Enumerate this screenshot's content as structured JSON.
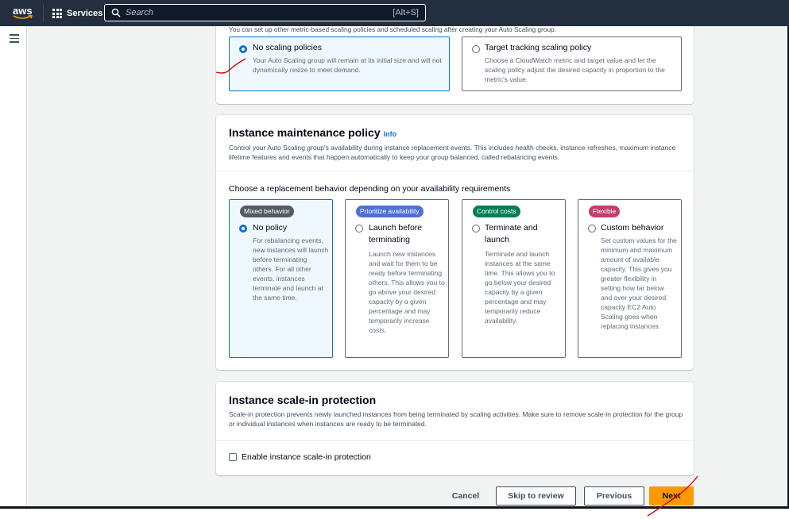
{
  "topbar": {
    "logo": "aws",
    "services_label": "Services",
    "search_placeholder": "Search",
    "search_shortcut": "[Alt+S]"
  },
  "scaling_policies": {
    "intro": "You can set up other metric-based scaling policies and scheduled scaling after creating your Auto Scaling group.",
    "options": [
      {
        "label": "No scaling policies",
        "description": "Your Auto Scaling group will remain at its initial size and will not dynamically resize to meet demand.",
        "selected": true
      },
      {
        "label": "Target tracking scaling policy",
        "description": "Choose a CloudWatch metric and target value and let the scaling policy adjust the desired capacity in proportion to the metric's value.",
        "selected": false
      }
    ]
  },
  "maintenance": {
    "title": "Instance maintenance policy",
    "info": "Info",
    "description": "Control your Auto Scaling group's availability during instance replacement events. This includes health checks, instance refreshes, maximum instance lifetime features and events that happen automatically to keep your group balanced, called rebalancing events.",
    "choose_label": "Choose a replacement behavior depending on your availability requirements",
    "options": [
      {
        "badge": "Mixed behavior",
        "badge_color": "#545b64",
        "label": "No policy",
        "description": "For rebalancing events, new instances will launch before terminating others. For all other events, instances terminate and launch at the same time.",
        "selected": true
      },
      {
        "badge": "Prioritize availability",
        "badge_color": "#4e6fd6",
        "label": "Launch before terminating",
        "description": "Launch new instances and wait for them to be ready before terminating others. This allows you to go above your desired capacity by a given percentage and may temporarily increase costs.",
        "selected": false
      },
      {
        "badge": "Control costs",
        "badge_color": "#037f51",
        "label": "Terminate and launch",
        "description": "Terminate and launch instances at the same time. This allows you to go below your desired capacity by a given percentage and may temporarily reduce availability.",
        "selected": false
      },
      {
        "badge": "Flexible",
        "badge_color": "#c33d69",
        "label": "Custom behavior",
        "description": "Set custom values for the minimum and maximum amount of available capacity. This gives you greater flexibility in setting how far below and over your desired capacity EC2 Auto Scaling goes when replacing instances.",
        "selected": false
      }
    ]
  },
  "scale_in": {
    "title": "Instance scale-in protection",
    "description": "Scale-in protection prevents newly launched instances from being terminated by scaling activities. Make sure to remove scale-in protection for the group or individual instances when instances are ready to be terminated.",
    "checkbox_label": "Enable instance scale-in protection",
    "checked": false
  },
  "footer": {
    "cancel": "Cancel",
    "skip": "Skip to review",
    "previous": "Previous",
    "next": "Next"
  }
}
